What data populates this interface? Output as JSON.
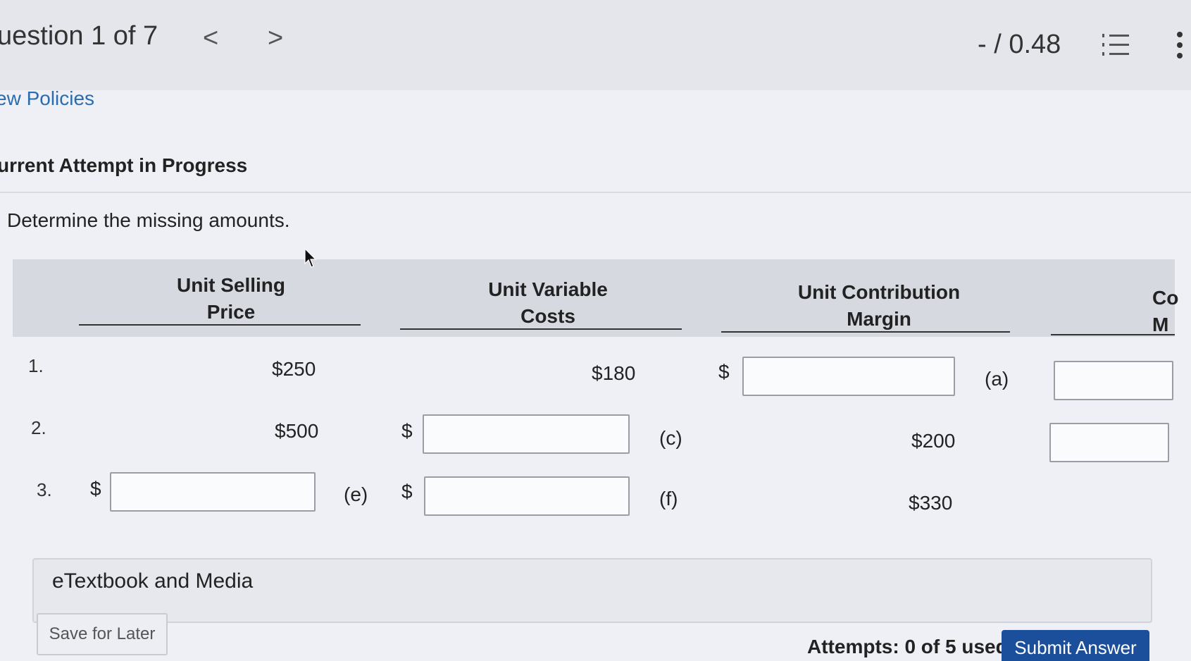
{
  "header": {
    "question_label": "uestion 1 of 7",
    "prev_glyph": "<",
    "next_glyph": ">",
    "score": "- / 0.48"
  },
  "links": {
    "policies": "ew Policies"
  },
  "status": {
    "attempt": "urrent Attempt in Progress"
  },
  "instructions": "Determine the missing amounts.",
  "table": {
    "headers": [
      {
        "line1": "Unit Selling",
        "line2": "Price"
      },
      {
        "line1": "Unit Variable",
        "line2": "Costs"
      },
      {
        "line1": "Unit Contribution",
        "line2": "Margin"
      },
      {
        "line1": "Co",
        "line2": "M"
      }
    ],
    "rows": [
      {
        "num": "1.",
        "selling": "$250",
        "variable": "$180",
        "dollar": "$",
        "tag_a": "(a)"
      },
      {
        "num": "2.",
        "selling": "$500",
        "dollar_var": "$",
        "tag_c": "(c)",
        "margin": "$200"
      },
      {
        "num": "3.",
        "dollar_sell": "$",
        "tag_e": "(e)",
        "dollar_var": "$",
        "tag_f": "(f)",
        "margin": "$330"
      }
    ]
  },
  "footer": {
    "etextbook": "eTextbook and Media",
    "save_label": "Save for Later",
    "attempts": "Attempts: 0 of 5 used",
    "submit_label": "Submit Answer"
  },
  "icons": {
    "list": "numbered-list-icon",
    "more": "more-vertical-icon",
    "prev": "chevron-left-icon",
    "next": "chevron-right-icon"
  },
  "colors": {
    "link": "#2b6cb0",
    "submit": "#1b4f9c",
    "header_bg": "#d7d9e1"
  }
}
